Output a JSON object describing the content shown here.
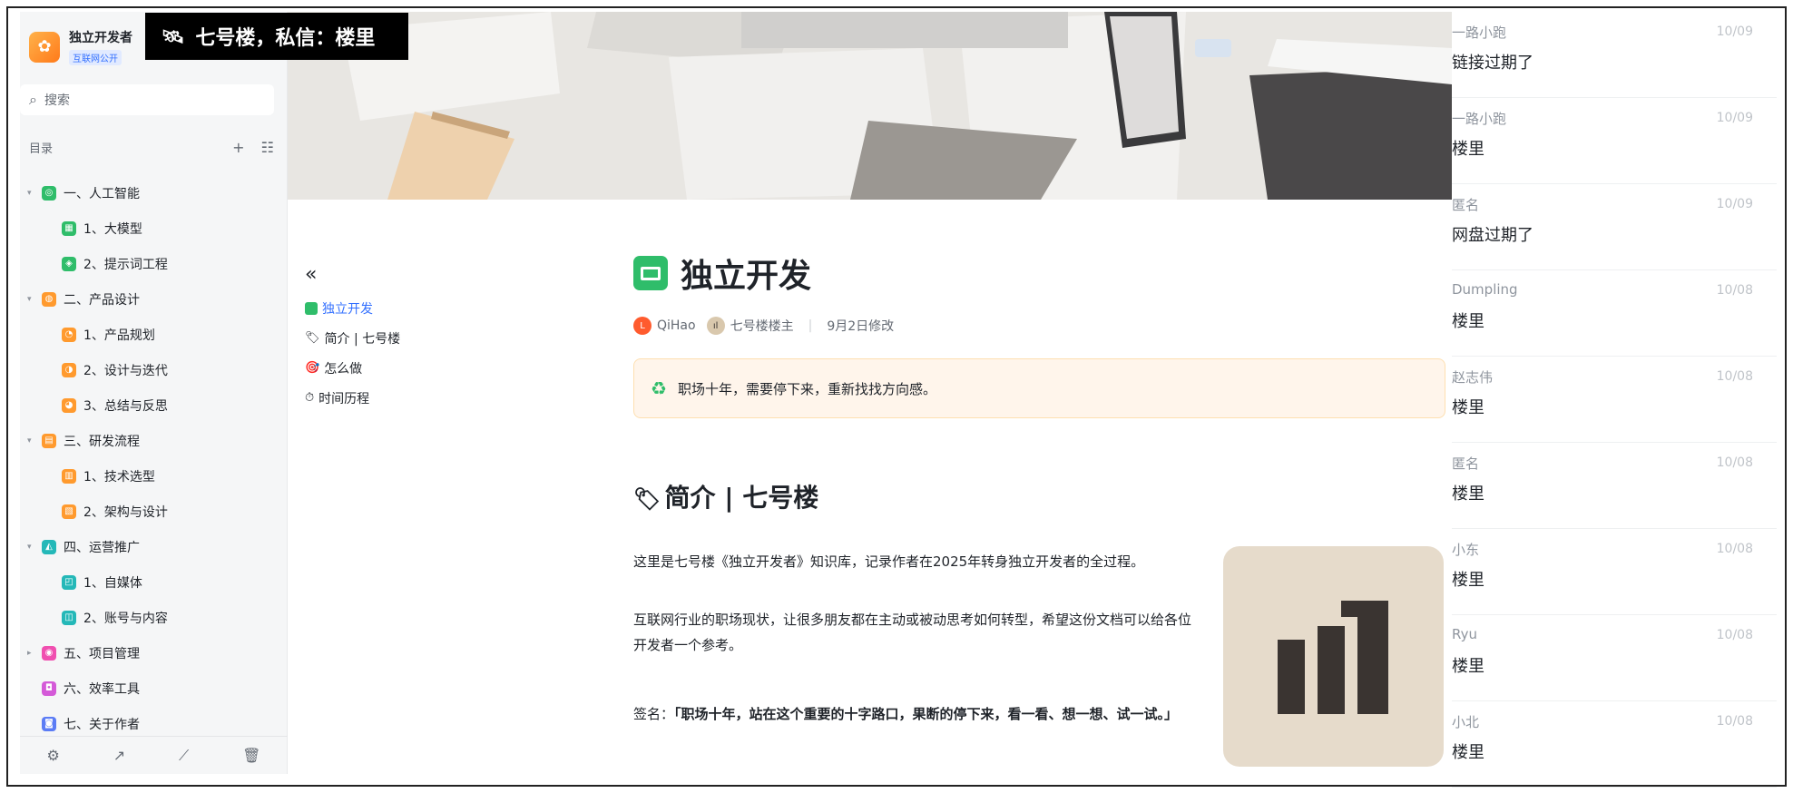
{
  "promo": {
    "icon": "🛰",
    "text": "七号楼，私信：楼里"
  },
  "sidebar": {
    "brand_name": "独立开发者",
    "brand_tag": "互联网公开",
    "search_placeholder": "搜索",
    "toc_label": "目录",
    "tree": [
      {
        "label": "一、人工智能",
        "color": "#2fbd6a",
        "glyph": "◎"
      },
      {
        "label": "1、大模型",
        "color": "#2fbd6a",
        "glyph": "▦"
      },
      {
        "label": "2、提示词工程",
        "color": "#2fbd6a",
        "glyph": "◈"
      },
      {
        "label": "二、产品设计",
        "color": "#ff9a2e",
        "glyph": "◍"
      },
      {
        "label": "1、产品规划",
        "color": "#ff9a2e",
        "glyph": "◔"
      },
      {
        "label": "2、设计与迭代",
        "color": "#ff9a2e",
        "glyph": "◑"
      },
      {
        "label": "3、总结与反思",
        "color": "#ff9a2e",
        "glyph": "◕"
      },
      {
        "label": "三、研发流程",
        "color": "#ff9a2e",
        "glyph": "▤"
      },
      {
        "label": "1、技术选型",
        "color": "#ff9a2e",
        "glyph": "▥"
      },
      {
        "label": "2、架构与设计",
        "color": "#ff9a2e",
        "glyph": "▧"
      },
      {
        "label": "四、运营推广",
        "color": "#24b8b8",
        "glyph": "◭"
      },
      {
        "label": "1、自媒体",
        "color": "#24b8b8",
        "glyph": "◰"
      },
      {
        "label": "2、账号与内容",
        "color": "#24b8b8",
        "glyph": "◫"
      },
      {
        "label": "五、项目管理",
        "color": "#f04fb0",
        "glyph": "◉"
      },
      {
        "label": "六、效率工具",
        "color": "#d45ad8",
        "glyph": "◘"
      },
      {
        "label": "七、关于作者",
        "color": "#5b7cf5",
        "glyph": "◙"
      }
    ]
  },
  "outline": {
    "items": [
      {
        "icon": "",
        "label": "独立开发"
      },
      {
        "icon": "🏷",
        "label": "简介 | 七号楼"
      },
      {
        "icon": "🎯",
        "label": "怎么做"
      },
      {
        "icon": "⏱",
        "label": "时间历程"
      }
    ]
  },
  "doc": {
    "title": "独立开发",
    "author1": "QiHao",
    "author2": "七号楼楼主",
    "modified": "9月2日修改",
    "callout": "职场十年，需要停下来，重新找找方向感。",
    "h2": "简介 | 七号楼",
    "para1": "这里是七号楼《独立开发者》知识库，记录作者在2025年转身独立开发者的全过程。",
    "para2": "互联网行业的职场现状，让很多朋友都在主动或被动思考如何转型，希望这份文档可以给各位开发者一个参考。",
    "sign_label": "签名：",
    "sign_text": "「职场十年，站在这个重要的十字路口，果断的停下来，看一看、想一想、试一试。」"
  },
  "comments": [
    {
      "user": "一路小跑",
      "date": "10/09",
      "text": "链接过期了"
    },
    {
      "user": "一路小跑",
      "date": "10/09",
      "text": "楼里"
    },
    {
      "user": "匿名",
      "date": "10/09",
      "text": "网盘过期了"
    },
    {
      "user": "Dumpling",
      "date": "10/08",
      "text": "楼里"
    },
    {
      "user": "赵志伟",
      "date": "10/08",
      "text": "楼里"
    },
    {
      "user": "匿名",
      "date": "10/08",
      "text": "楼里"
    },
    {
      "user": "小东",
      "date": "10/08",
      "text": "楼里"
    },
    {
      "user": "Ryu",
      "date": "10/08",
      "text": "楼里"
    },
    {
      "user": "小北",
      "date": "10/08",
      "text": "楼里"
    }
  ]
}
